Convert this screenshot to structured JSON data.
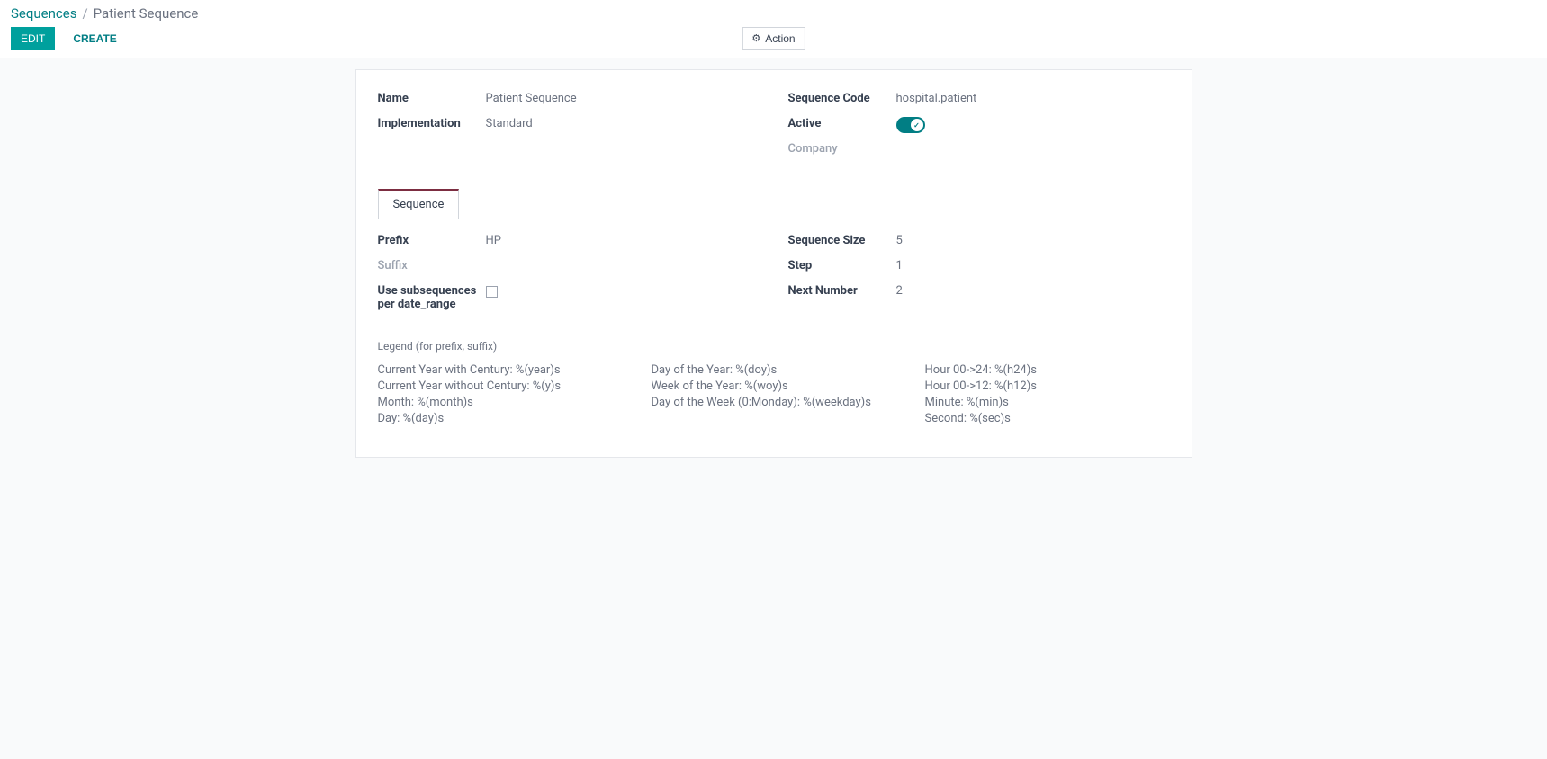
{
  "breadcrumb": {
    "parent": "Sequences",
    "sep": "/",
    "current": "Patient Sequence"
  },
  "toolbar": {
    "edit": "EDIT",
    "create": "CREATE",
    "action": "Action"
  },
  "form": {
    "left": {
      "name_label": "Name",
      "name_value": "Patient Sequence",
      "implementation_label": "Implementation",
      "implementation_value": "Standard"
    },
    "right": {
      "sequence_code_label": "Sequence Code",
      "sequence_code_value": "hospital.patient",
      "active_label": "Active",
      "company_label": "Company"
    }
  },
  "tabs": {
    "sequence": "Sequence"
  },
  "sequence_tab": {
    "left": {
      "prefix_label": "Prefix",
      "prefix_value": "HP",
      "suffix_label": "Suffix",
      "use_subseq_label": "Use subsequences per date_range"
    },
    "right": {
      "size_label": "Sequence Size",
      "size_value": "5",
      "step_label": "Step",
      "step_value": "1",
      "next_label": "Next Number",
      "next_value": "2"
    }
  },
  "legend": {
    "title": "Legend (for prefix, suffix)",
    "col1": {
      "l1": "Current Year with Century: %(year)s",
      "l2": "Current Year without Century: %(y)s",
      "l3": "Month: %(month)s",
      "l4": "Day: %(day)s"
    },
    "col2": {
      "l1": "Day of the Year: %(doy)s",
      "l2": "Week of the Year: %(woy)s",
      "l3": "Day of the Week (0:Monday): %(weekday)s"
    },
    "col3": {
      "l1": "Hour 00->24: %(h24)s",
      "l2": "Hour 00->12: %(h12)s",
      "l3": "Minute: %(min)s",
      "l4": "Second: %(sec)s"
    }
  }
}
